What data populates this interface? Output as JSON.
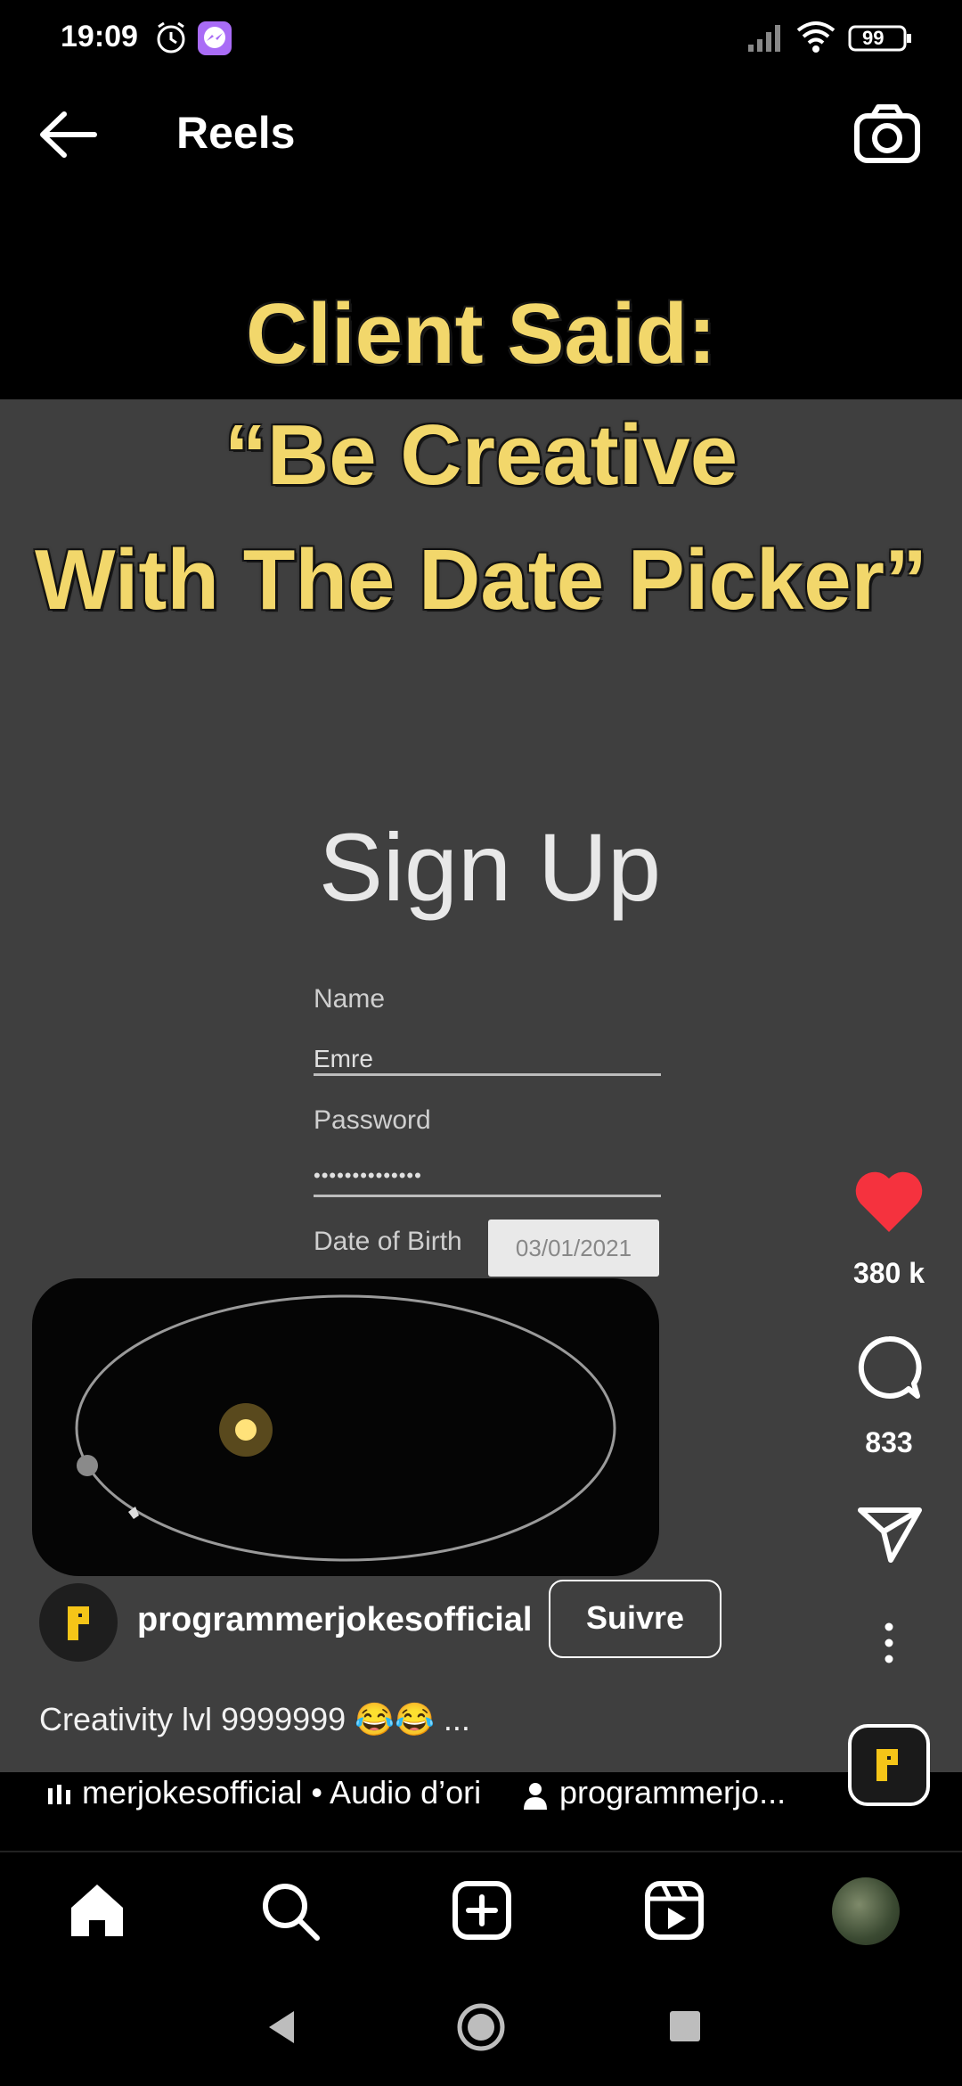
{
  "status_bar": {
    "time": "19:09",
    "battery": "99"
  },
  "header": {
    "title": "Reels"
  },
  "video": {
    "overlay_lines": [
      "Client Said:",
      "“Be Creative",
      "With The Date Picker”"
    ],
    "signup_title": "Sign Up",
    "name_label": "Name",
    "name_value": "Emre",
    "password_label": "Password",
    "password_value": "••••••••••••••",
    "dob_label": "Date of Birth",
    "dob_value": "03/01/2021"
  },
  "actions": {
    "likes": "380 k",
    "comments": "833"
  },
  "post": {
    "username": "programmerjokesofficial",
    "follow_label": "Suivre",
    "caption": "Creativity lvl 9999999 😂😂 ...",
    "audio_text": "merjokesofficial • Audio d’ori",
    "audio_user": "programmerjo..."
  },
  "colors": {
    "accent_heart": "#f5323e",
    "overlay_text": "#f2d76b",
    "brand_badge": "#f5c518"
  }
}
